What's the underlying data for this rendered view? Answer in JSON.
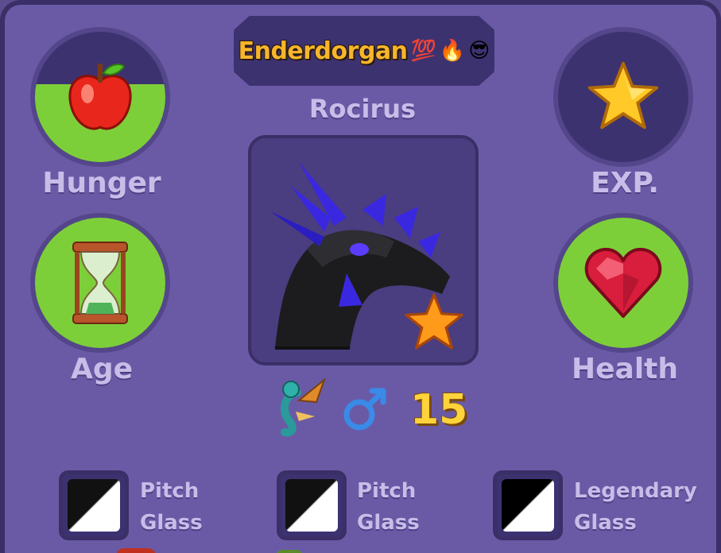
{
  "owner": {
    "name": "Enderdorgan",
    "emojis": [
      "💯",
      "🔥",
      "😎"
    ]
  },
  "pet": {
    "name": "Rocirus",
    "level": "15",
    "gender": "male",
    "species_icon": "dragon-icon",
    "rarity_icon": "star-icon"
  },
  "stats": [
    {
      "id": "hunger",
      "label": "Hunger",
      "icon": "apple-icon",
      "fill": 0.6
    },
    {
      "id": "exp",
      "label": "EXP.",
      "icon": "star-icon",
      "fill": 0
    },
    {
      "id": "age",
      "label": "Age",
      "icon": "hourglass-icon",
      "fill": 1
    },
    {
      "id": "health",
      "label": "Health",
      "icon": "heart-icon",
      "fill": 1
    }
  ],
  "items": [
    {
      "line1": "Pitch",
      "line2": "Glass"
    },
    {
      "line1": "Pitch",
      "line2": "Glass"
    },
    {
      "line1": "Legendary",
      "line2": "Glass"
    }
  ],
  "colors": {
    "panel": "#6a5aa6",
    "stat_fill": "#7dcf3a",
    "owner_name": "#f7b52a",
    "level": "#ffd33a"
  }
}
